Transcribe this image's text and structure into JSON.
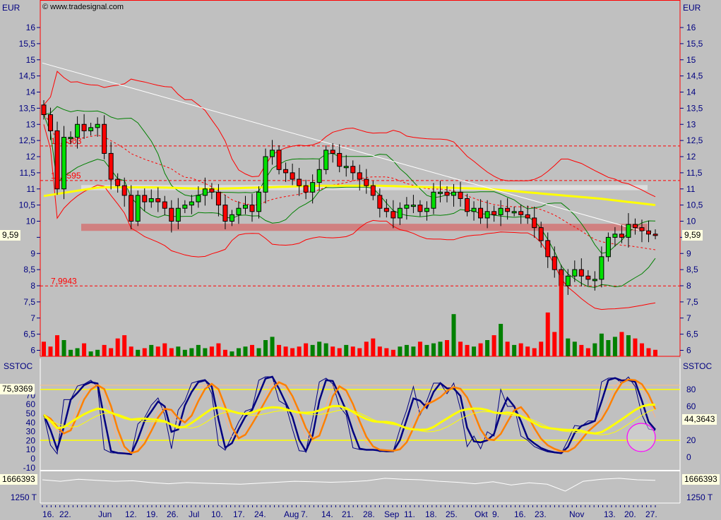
{
  "header": {
    "currency": "EUR",
    "credit": "© www.tradesignal.com"
  },
  "price_panel": {
    "last_price_label": "9,59",
    "levels": [
      "12,3303",
      "11,2595",
      "7,9943"
    ]
  },
  "sstoc_panel": {
    "title": "SSTOC",
    "left_value": "75,9369",
    "right_value": "44,3643"
  },
  "volume_panel": {
    "left_value": "1666393",
    "right_value": "1666393",
    "unit_label": "1250 T"
  },
  "colors": {
    "up": "#00e000",
    "down": "#ff0000",
    "band": "#ff0000",
    "green_band": "#008000",
    "ma": "#ffff00",
    "trend": "#ffffff",
    "k": "#000080",
    "d": "#ff8000",
    "circle": "#ff00ff"
  },
  "chart_data": {
    "type": "candlestick",
    "title": "EUR",
    "ylabel": "EUR",
    "ylim": [
      5.8,
      16.8
    ],
    "y_ticks": [
      "16",
      "15,5",
      "15",
      "14,5",
      "14",
      "13,5",
      "13",
      "12,5",
      "12",
      "11,5",
      "11",
      "10,5",
      "10",
      "9,5",
      "9",
      "8,5",
      "8",
      "7,5",
      "7",
      "6,5",
      "6"
    ],
    "sstoc_left_ticks": [
      "70",
      "60",
      "50",
      "40",
      "30",
      "20",
      "10",
      "0",
      "-10"
    ],
    "sstoc_right_ticks": [
      "80",
      "60",
      "20",
      "0"
    ],
    "x_ticks": [
      "16.",
      "22.",
      "Jun",
      "12.",
      "19.",
      "26.",
      "Jul",
      "10.",
      "17.",
      "24.",
      "Aug",
      "7.",
      "14.",
      "21.",
      "28.",
      "Sep",
      "11.",
      "18.",
      "25.",
      "Okt",
      "9.",
      "16.",
      "23.",
      "Nov",
      "13.",
      "20.",
      "27."
    ],
    "closes": [
      13.3,
      12.8,
      11.0,
      12.6,
      12.6,
      13.0,
      12.8,
      12.9,
      13.0,
      12.1,
      11.3,
      11.1,
      10.8,
      10.0,
      10.8,
      10.6,
      10.7,
      10.6,
      10.4,
      10.0,
      10.4,
      10.5,
      10.6,
      10.8,
      11.0,
      10.9,
      10.5,
      10.0,
      10.2,
      10.4,
      10.5,
      10.3,
      10.9,
      12.0,
      12.2,
      11.6,
      11.5,
      11.3,
      11.1,
      10.9,
      11.2,
      11.6,
      12.2,
      12.1,
      11.7,
      11.7,
      11.5,
      11.3,
      11.1,
      10.8,
      10.4,
      10.3,
      10.1,
      10.4,
      10.5,
      10.5,
      10.3,
      10.4,
      10.9,
      10.9,
      10.8,
      10.9,
      10.7,
      10.3,
      10.4,
      10.1,
      10.3,
      10.2,
      10.4,
      10.3,
      10.3,
      10.2,
      10.1,
      9.8,
      9.4,
      8.9,
      8.5,
      8.0,
      8.3,
      8.5,
      8.3,
      8.2,
      8.2,
      8.9,
      9.5,
      9.6,
      9.5,
      9.9,
      9.8,
      9.7,
      9.6,
      9.59
    ],
    "volume": [
      18,
      12,
      26,
      20,
      8,
      10,
      16,
      6,
      8,
      14,
      10,
      22,
      26,
      12,
      8,
      10,
      14,
      12,
      16,
      10,
      12,
      8,
      10,
      14,
      10,
      12,
      16,
      8,
      6,
      10,
      12,
      14,
      10,
      20,
      24,
      14,
      12,
      10,
      12,
      16,
      14,
      18,
      16,
      12,
      10,
      14,
      12,
      10,
      18,
      22,
      12,
      10,
      8,
      12,
      14,
      12,
      18,
      14,
      16,
      18,
      20,
      52,
      18,
      14,
      12,
      16,
      20,
      26,
      40,
      18,
      14,
      16,
      12,
      10,
      18,
      54,
      30,
      100,
      22,
      18,
      14,
      10,
      16,
      28,
      20,
      24,
      30,
      26,
      22,
      16,
      10,
      8
    ],
    "horizontal_levels": [
      12.3303,
      11.2595,
      7.9943
    ],
    "support_zone": [
      9.7,
      9.92
    ],
    "resistance_zone": [
      10.96,
      11.12
    ],
    "trendline": [
      14.9,
      9.58
    ],
    "ma_long": [
      10.78,
      11.05,
      11.05,
      11.0,
      11.05,
      11.1,
      11.1,
      11.05,
      11.0,
      10.85,
      10.7,
      10.5
    ],
    "sstoc_levels": [
      80,
      20,
      85
    ],
    "volume_line": [
      1666,
      1660,
      1668,
      1664,
      1660,
      1662,
      1655,
      1650,
      1655,
      1652,
      1650,
      1648,
      1652,
      1656,
      1660,
      1658,
      1656,
      1658,
      1662,
      1672,
      1668,
      1666,
      1660,
      1656,
      1650,
      1658,
      1645,
      1654,
      1648,
      1620,
      1660,
      1668,
      1672,
      1666,
      1664
    ]
  }
}
